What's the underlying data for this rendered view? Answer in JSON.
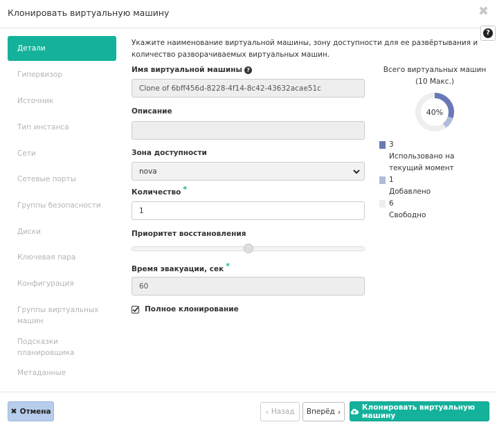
{
  "modal": {
    "title": "Клонировать виртуальную машину",
    "close_glyph": "✖",
    "help_glyph": "?"
  },
  "nav": {
    "items": [
      {
        "label": "Детали",
        "active": true
      },
      {
        "label": "Гипервизор"
      },
      {
        "label": "Источник"
      },
      {
        "label": "Тип инстанса"
      },
      {
        "label": "Сети"
      },
      {
        "label": "Сетевые порты"
      },
      {
        "label": "Группы безопасности"
      },
      {
        "label": "Диски"
      },
      {
        "label": "Ключевая пара"
      },
      {
        "label": "Конфигурация"
      },
      {
        "label": "Группы виртуальных машин"
      },
      {
        "label": "Подсказки планировщика"
      },
      {
        "label": "Метаданные"
      }
    ]
  },
  "form": {
    "intro": "Укажите наименование виртуальной машины, зону доступности для ее развёртывания и количество разворачиваемых виртуальных машин.",
    "name_label": "Имя виртуальной машины",
    "name_value": "Clone of 6bff456d-8228-4f14-8c42-43632acae51c",
    "description_label": "Описание",
    "description_value": "",
    "zone_label": "Зона доступности",
    "zone_value": "nova",
    "count_label": "Количество",
    "count_value": "1",
    "priority_label": "Приоритет восстановления",
    "priority_level_fraction": 0.5,
    "evac_label": "Время эвакуации, сек",
    "evac_value": "60",
    "full_clone_label": "Полное клонирование",
    "full_clone_checked": true,
    "required_mark": "*"
  },
  "quota": {
    "title": "Всего виртуальных машин",
    "subtitle": "(10 Макс.)",
    "percent_label": "40%",
    "max": 10,
    "legend": [
      {
        "count": "3",
        "label": "Использовано на текущий момент",
        "color": "#6a78b6"
      },
      {
        "count": "1",
        "label": "Добавлено",
        "color": "#b1bbd9"
      },
      {
        "count": "6",
        "label": "Свободно",
        "color": "#eeeeee"
      }
    ]
  },
  "footer": {
    "cancel_label": "Отмена",
    "back_label": "Назад",
    "next_label": "Вперёд",
    "clone_label": "Клонировать виртуальную машину"
  },
  "colors": {
    "accent": "#14b29b",
    "cancel_bg": "#b7cdeb"
  }
}
